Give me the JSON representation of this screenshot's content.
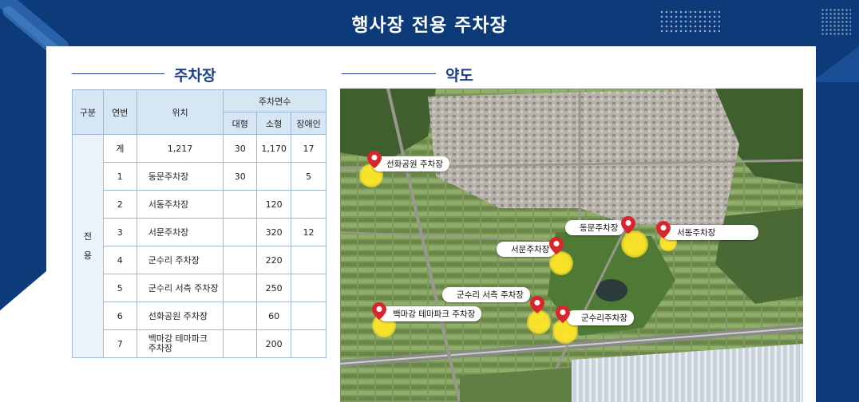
{
  "header": {
    "title": "행사장 전용 주차장"
  },
  "parking_section": {
    "title": "주차장"
  },
  "map_section": {
    "title": "약도"
  },
  "table": {
    "headers": {
      "gubun": "구분",
      "num": "연번",
      "location": "위치",
      "spaces": "주차면수",
      "large": "대형",
      "small": "소형",
      "disabled": "장애인"
    },
    "gubun_label": "전\n\n용",
    "rows": [
      {
        "num": "계",
        "name": "1,217",
        "large": "30",
        "small": "1,170",
        "disabled": "17"
      },
      {
        "num": "1",
        "name": "동문주차장",
        "large": "30",
        "small": "",
        "disabled": "5"
      },
      {
        "num": "2",
        "name": "서동주차장",
        "large": "",
        "small": "120",
        "disabled": ""
      },
      {
        "num": "3",
        "name": "서문주차장",
        "large": "",
        "small": "320",
        "disabled": "12"
      },
      {
        "num": "4",
        "name": "군수리 주차장",
        "large": "",
        "small": "220",
        "disabled": ""
      },
      {
        "num": "5",
        "name": "군수리 서측 주차장",
        "large": "",
        "small": "250",
        "disabled": ""
      },
      {
        "num": "6",
        "name": "선화공원 주차장",
        "large": "",
        "small": "60",
        "disabled": ""
      },
      {
        "num": "7",
        "name": "백마강 테마파크\n주차장",
        "large": "",
        "small": "200",
        "disabled": ""
      }
    ]
  },
  "map": {
    "labels": {
      "seonhwa": "선화공원 주차장",
      "dongmun": "동문주차장",
      "seodong": "서동주차장",
      "seomun": "서문주차장",
      "gunsuri_west": "군수리 서측 주차장",
      "baekmagang": "백마강 테마파크 주차장",
      "gunsuri": "군수리주차장"
    },
    "pin_color": "#d9252b",
    "spot_color": "#ffe628"
  }
}
